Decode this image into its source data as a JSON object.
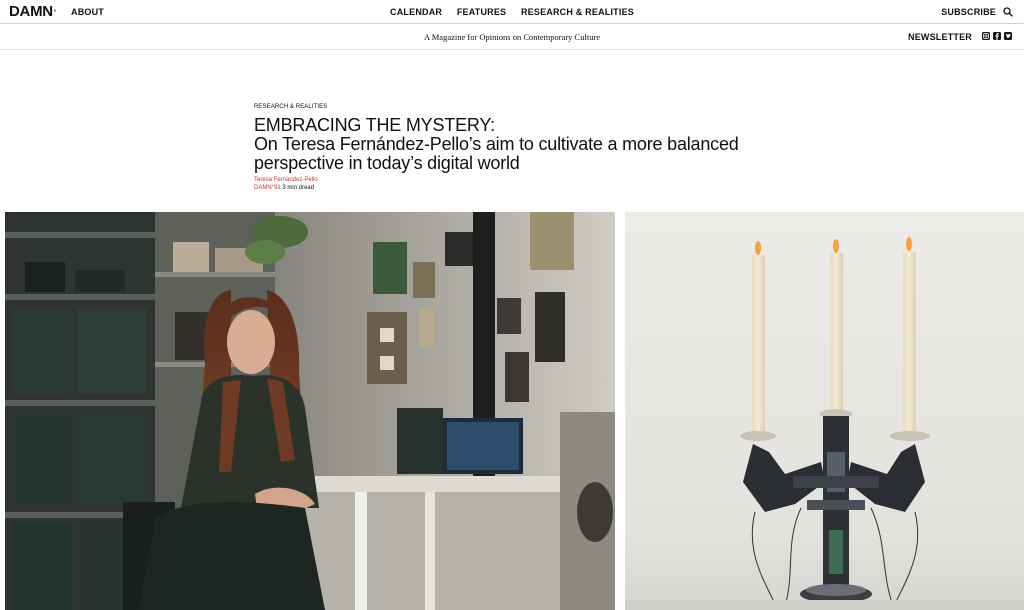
{
  "nav": {
    "logo": "DAMN",
    "logo_mark": "°",
    "about": "ABOUT",
    "center": [
      "CALENDAR",
      "FEATURES",
      "RESEARCH & REALITIES"
    ],
    "subscribe": "SUBSCRIBE",
    "search_icon": "search-icon"
  },
  "subbar": {
    "tagline": "A Magazine for Opinions on Contemporary Culture",
    "newsletter": "NEWSLETTER",
    "social_icons": [
      "instagram-icon",
      "facebook-icon",
      "twitter-icon"
    ]
  },
  "article": {
    "category": "RESEARCH & REALITIES",
    "headline_line1": "EMBRACING THE MYSTERY:",
    "headline_line2": "On Teresa Fernández-Pello’s aim to cultivate a more balanced",
    "headline_line3": "perspective in today’s digital world",
    "author": "Teresa Fernández-Pello",
    "issue": "DAMN°91",
    "read_time": "3 min dread"
  },
  "colors": {
    "accent": "#c0392b",
    "text": "#111111",
    "divider": "#cfcfcf"
  }
}
